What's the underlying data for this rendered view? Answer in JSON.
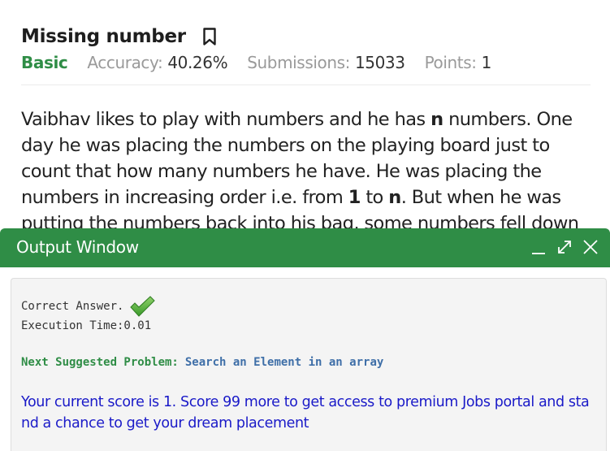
{
  "problem": {
    "title": "Missing number",
    "bookmark_icon": "bookmark-icon",
    "difficulty": "Basic",
    "accuracy_label": "Accuracy:",
    "accuracy_value": "40.26%",
    "submissions_label": "Submissions:",
    "submissions_value": "15033",
    "points_label": "Points:",
    "points_value": "1",
    "statement": {
      "l1": "Vaibhav likes to play with numbers and he has ",
      "l1_bold": "n",
      "l1_end": " numbers. One",
      "l2": "day he was placing the numbers on the playing board just to",
      "l3": "count that how many numbers he have. He was placing the",
      "l4a": "numbers in increasing order i.e. from ",
      "l4_bold1": "1",
      "l4b": " to ",
      "l4_bold2": "n",
      "l4c": ". But when he was",
      "l5": "putting the numbers back into his bag, some numbers fell down"
    }
  },
  "output_window": {
    "title": "Output Window",
    "controls": {
      "minimize_icon": "minimize-icon",
      "expand_icon": "expand-icon",
      "close_icon": "close-icon"
    },
    "result": "Correct Answer.",
    "result_icon": "checkmark-icon",
    "execution_time": "Execution Time:0.01",
    "suggest_label": "Next Suggested Problem:",
    "suggest_link": "Search an Element in an array",
    "score_message": "Your current score is 1. Score 99 more to get access to premium Jobs portal and sta nd a chance to get your dream placement"
  },
  "colors": {
    "brand_green": "#2f8d46",
    "link_blue": "#3f6fa8",
    "score_blue": "#1a1ac8"
  }
}
